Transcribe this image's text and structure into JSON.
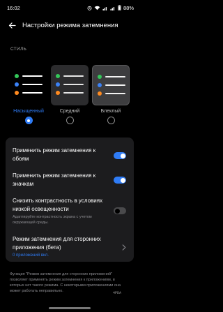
{
  "status_bar": {
    "time": "16:02",
    "battery": "88%"
  },
  "header": {
    "title": "Настройки режима затемнения"
  },
  "style_section": {
    "label": "СТИЛЬ"
  },
  "themes": [
    {
      "label": "Насыщенный",
      "selected": true
    },
    {
      "label": "Средний",
      "selected": false
    },
    {
      "label": "Блеклый",
      "selected": false
    }
  ],
  "colors": {
    "accent": "#2f7cf6",
    "dot_green": "#34c759",
    "dot_blue": "#3b82f6",
    "dot_orange": "#ff8a1f"
  },
  "settings": {
    "wallpaper": {
      "title": "Применить режим затемнения к обоям",
      "enabled": true
    },
    "icons": {
      "title": "Применить режим затемнения к значкам",
      "enabled": true
    },
    "contrast": {
      "title": "Снизить контрастность в условиях низкой освещенности",
      "subtitle": "Адаптируйте контрастность экрана с учетом окружающей среды.",
      "enabled": false
    },
    "third_party": {
      "title": "Режим затемнения для сторонних приложения (бета)",
      "subtitle": "0 приложений вкл."
    }
  },
  "footnote": "Функция \"Режим затемнения для сторонних приложений\" позволяет применять режим затемнения к приложениям, в которых нет такого режима. С некоторыми приложениями она может работать неправильно.",
  "watermark": "4PDA"
}
